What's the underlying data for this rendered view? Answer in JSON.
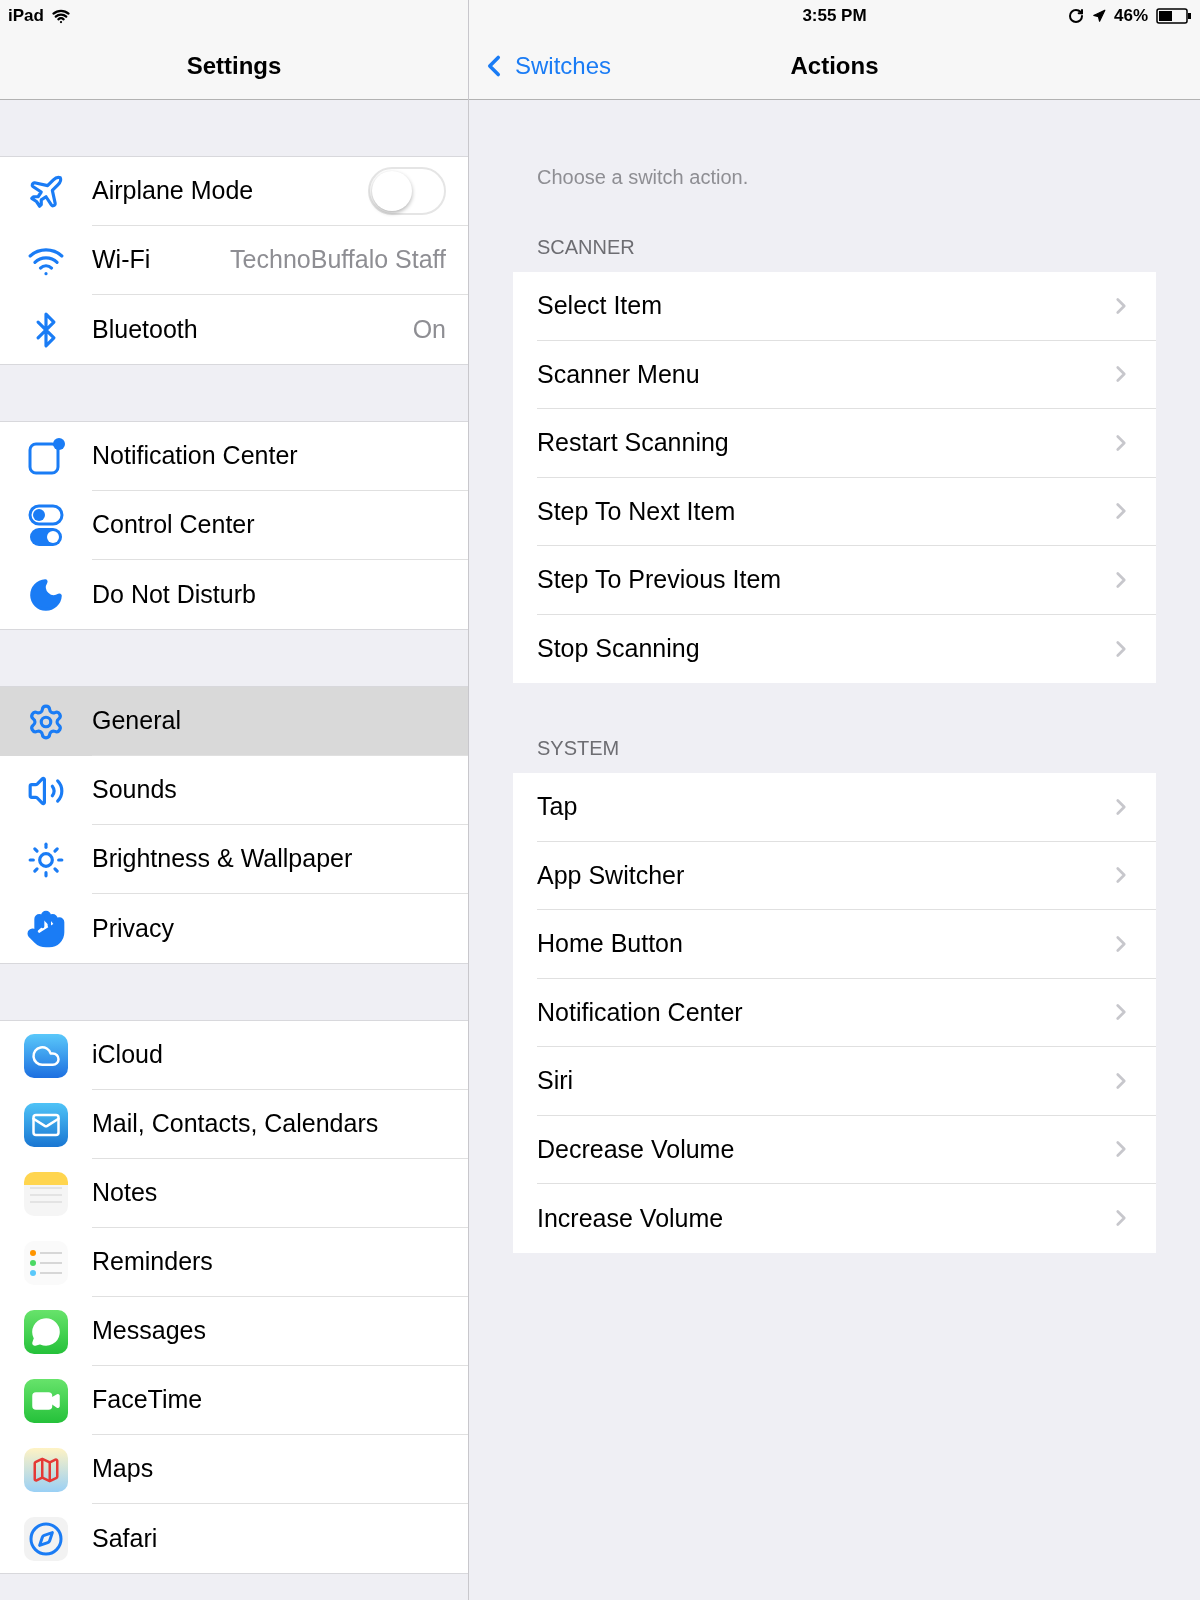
{
  "status_bar": {
    "device": "iPad",
    "time": "3:55 PM",
    "battery": "46%"
  },
  "sidebar": {
    "title": "Settings",
    "groups": [
      [
        {
          "label": "Airplane Mode",
          "kind": "toggle",
          "on": false,
          "selected": false
        },
        {
          "label": "Wi-Fi",
          "kind": "value",
          "value": "TechnoBuffalo Staff",
          "selected": false
        },
        {
          "label": "Bluetooth",
          "kind": "value",
          "value": "On",
          "selected": false
        }
      ],
      [
        {
          "label": "Notification Center",
          "kind": "link",
          "selected": false
        },
        {
          "label": "Control Center",
          "kind": "link",
          "selected": false
        },
        {
          "label": "Do Not Disturb",
          "kind": "link",
          "selected": false
        }
      ],
      [
        {
          "label": "General",
          "kind": "link",
          "selected": true
        },
        {
          "label": "Sounds",
          "kind": "link",
          "selected": false
        },
        {
          "label": "Brightness & Wallpaper",
          "kind": "link",
          "selected": false
        },
        {
          "label": "Privacy",
          "kind": "link",
          "selected": false
        }
      ],
      [
        {
          "label": "iCloud",
          "kind": "link",
          "selected": false
        },
        {
          "label": "Mail, Contacts, Calendars",
          "kind": "link",
          "selected": false
        },
        {
          "label": "Notes",
          "kind": "link",
          "selected": false
        },
        {
          "label": "Reminders",
          "kind": "link",
          "selected": false
        },
        {
          "label": "Messages",
          "kind": "link",
          "selected": false
        },
        {
          "label": "FaceTime",
          "kind": "link",
          "selected": false
        },
        {
          "label": "Maps",
          "kind": "link",
          "selected": false
        },
        {
          "label": "Safari",
          "kind": "link",
          "selected": false
        }
      ]
    ]
  },
  "detail": {
    "back": "Switches",
    "title": "Actions",
    "description": "Choose a switch action.",
    "sections": [
      {
        "header": "SCANNER",
        "items": [
          "Select Item",
          "Scanner Menu",
          "Restart Scanning",
          "Step To Next Item",
          "Step To Previous Item",
          "Stop Scanning"
        ]
      },
      {
        "header": "SYSTEM",
        "items": [
          "Tap",
          "App Switcher",
          "Home Button",
          "Notification Center",
          "Siri",
          "Decrease Volume",
          "Increase Volume"
        ]
      }
    ]
  }
}
